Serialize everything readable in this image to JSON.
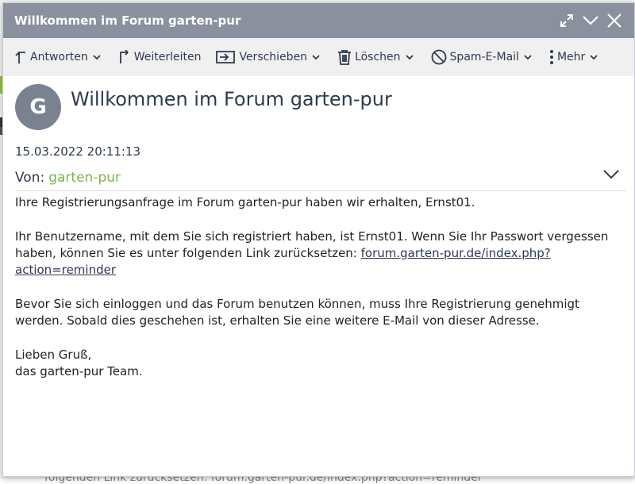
{
  "window": {
    "title": "Willkommen im Forum garten-pur",
    "controls": [
      "expand-icon",
      "chevron-down-icon",
      "close-icon"
    ]
  },
  "toolbar": {
    "reply_label": "Antworten",
    "forward_label": "Weiterleiten",
    "move_label": "Verschieben",
    "delete_label": "Löschen",
    "spam_label": "Spam-E-Mail",
    "more_label": "Mehr"
  },
  "message": {
    "avatar_letter": "G",
    "subject": "Willkommen im Forum garten-pur",
    "date": "15.03.2022 20:11:13",
    "from_label": "Von:",
    "from_value": "garten-pur",
    "body": {
      "p1": "Ihre Registrierungsanfrage im Forum garten-pur haben wir erhalten, Ernst01.",
      "p2_text": "Ihr Benutzername, mit dem Sie sich registriert haben, ist Ernst01. Wenn Sie Ihr Passwort vergessen haben, können Sie es unter folgenden Link zurücksetzen: ",
      "p2_link": "forum.garten-pur.de/index.php?action=reminder",
      "p3": "Bevor Sie sich einloggen und das Forum benutzen können, muss Ihre Registrierung genehmigt werden. Sobald dies geschehen ist, erhalten Sie eine weitere E-Mail von dieser Adresse.",
      "greeting": "Lieben Gruß,",
      "signature": "das garten-pur Team."
    }
  },
  "background": {
    "partial_text": "folgenden Link zurücksetzen: forum.garten-pur.de/index.php?action=reminder"
  },
  "colors": {
    "titlebar": "#8a909e",
    "toolbar": "#f0f0f0",
    "avatar": "#7a8291",
    "sender": "#7ab648",
    "text": "#2e3a4d"
  }
}
